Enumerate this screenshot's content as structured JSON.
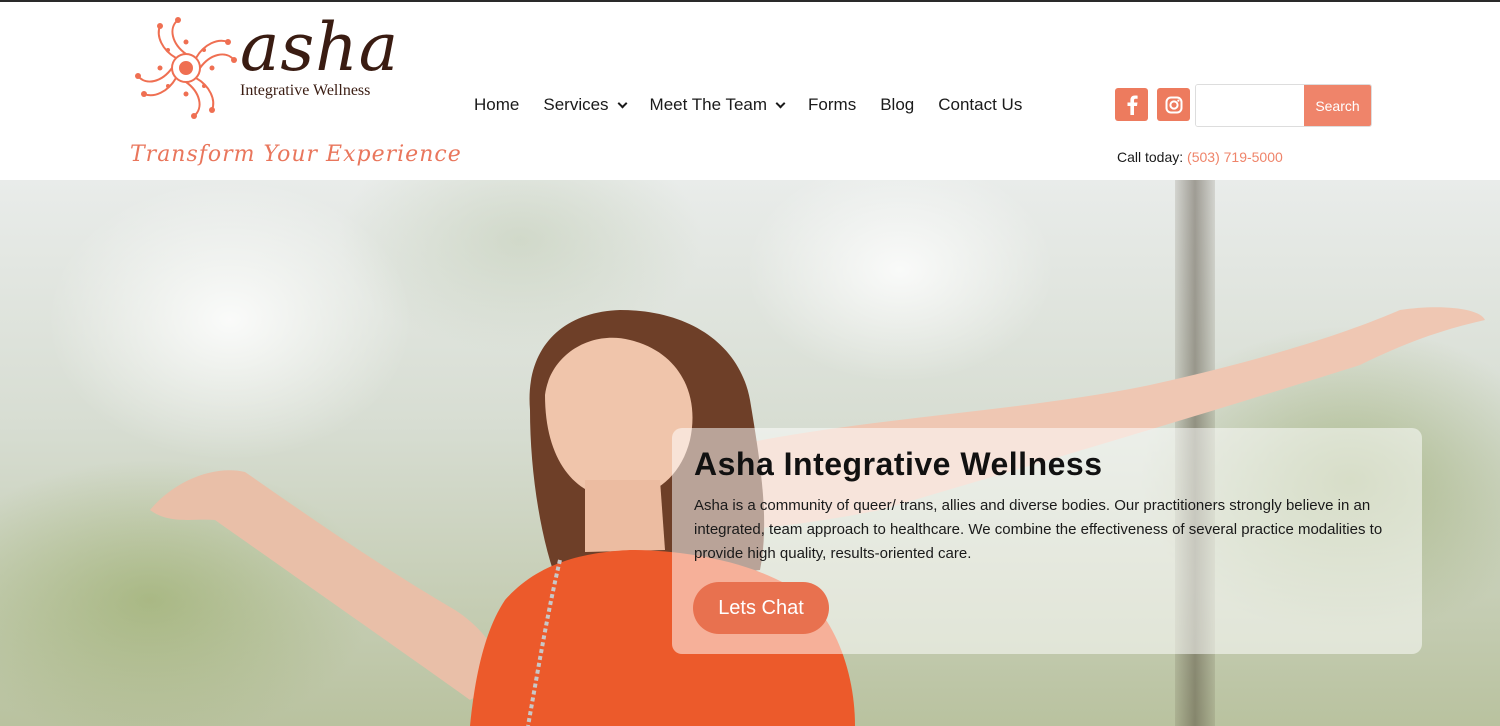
{
  "brand": {
    "name": "asha",
    "subtitle": "Integrative Wellness",
    "tagline": "Transform Your Experience",
    "accent_color": "#ef846a",
    "dark_color": "#3a1c12"
  },
  "nav": {
    "items": [
      {
        "label": "Home",
        "has_dropdown": false
      },
      {
        "label": "Services",
        "has_dropdown": true
      },
      {
        "label": "Meet The Team",
        "has_dropdown": true
      },
      {
        "label": "Forms",
        "has_dropdown": false
      },
      {
        "label": "Blog",
        "has_dropdown": false
      },
      {
        "label": "Contact Us",
        "has_dropdown": false
      }
    ]
  },
  "social": {
    "facebook_icon": "facebook-icon",
    "instagram_icon": "instagram-icon"
  },
  "search": {
    "value": "",
    "placeholder": "",
    "button_label": "Search"
  },
  "contact": {
    "call_label": "Call today:",
    "phone": "(503) 719-5000"
  },
  "hero": {
    "title": "Asha Integrative Wellness",
    "body": "Asha is a community of queer/ trans, allies and diverse bodies. Our practitioners strongly believe in an integrated, team approach to healthcare. We combine the effectiveness of several practice modalities to provide high quality, results-oriented care.",
    "cta_label": "Lets Chat",
    "cta_color": "#e8714f"
  }
}
